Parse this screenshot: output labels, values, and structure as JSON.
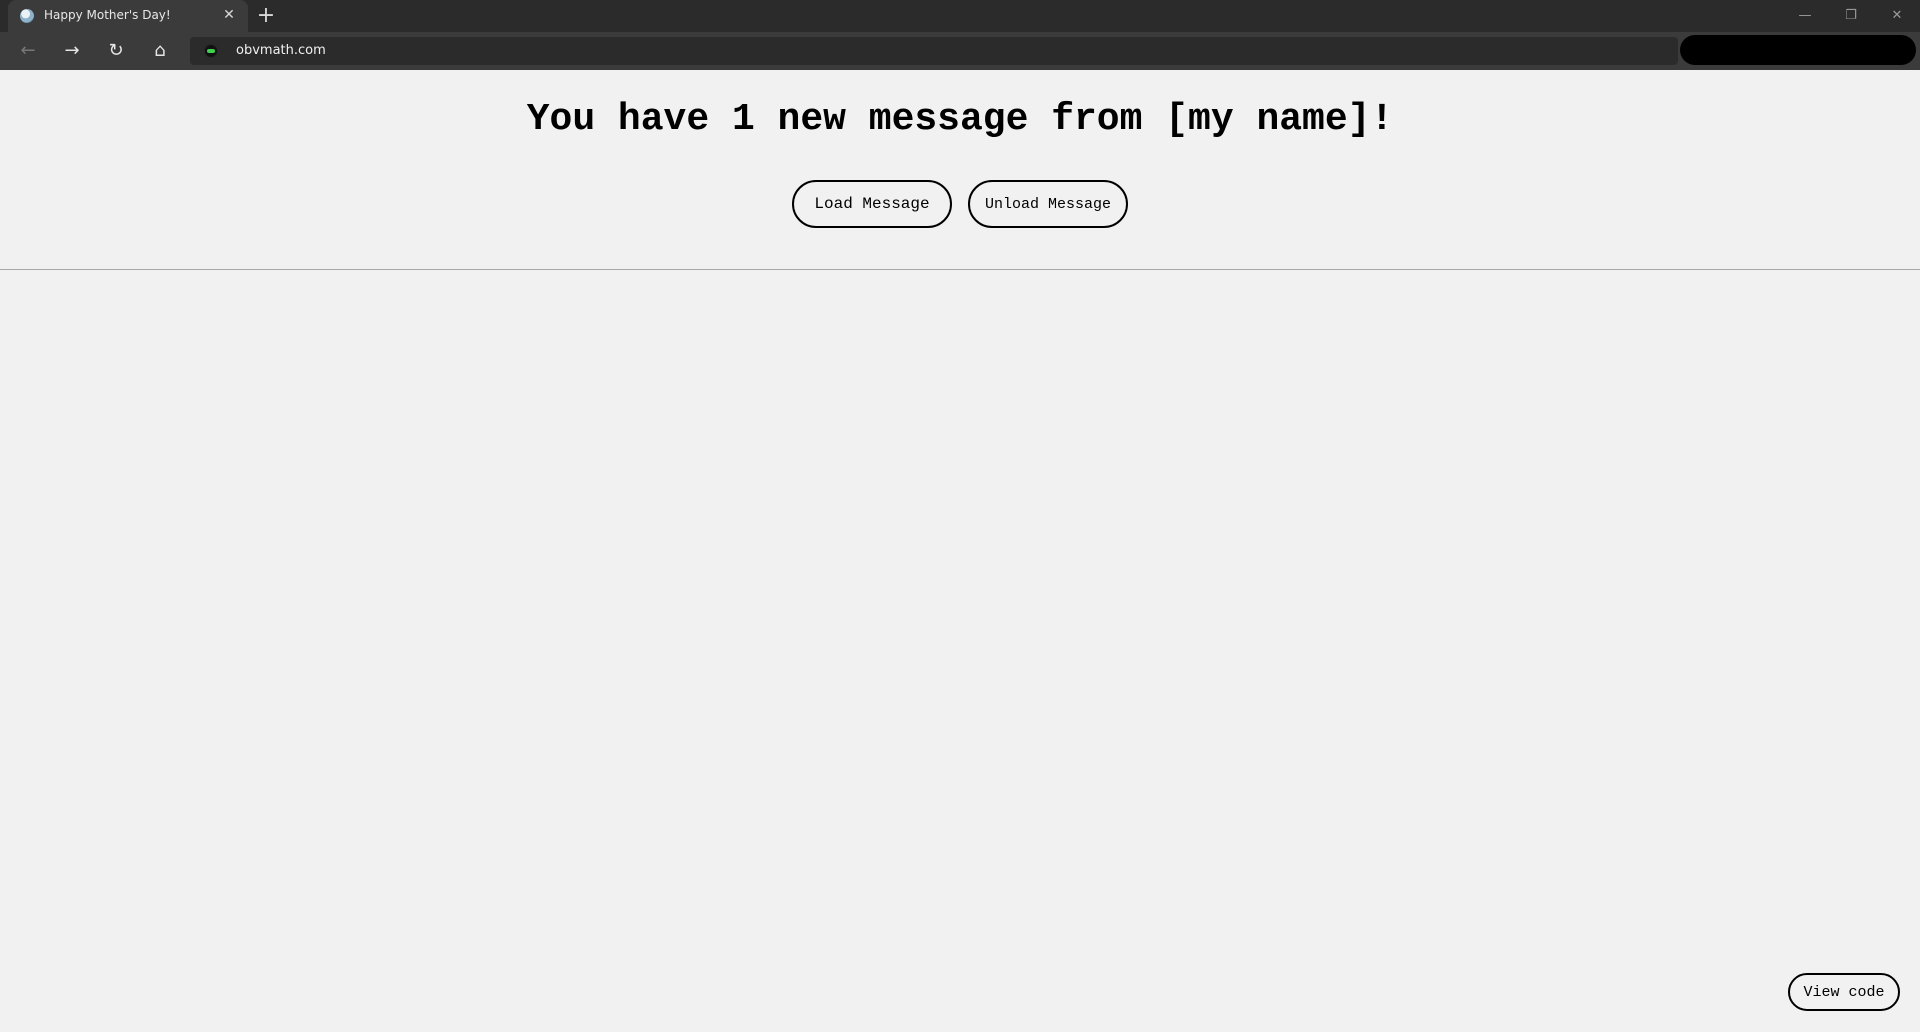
{
  "browser": {
    "tab": {
      "title": "Happy Mother's Day!",
      "close_glyph": "✕",
      "favicon": "globe-favicon"
    },
    "new_tab_glyph": "+",
    "window_controls": {
      "minimize": "—",
      "restore": "❐",
      "close": "✕"
    },
    "nav": {
      "back": "←",
      "forward": "→",
      "reload": "↻",
      "home": "⌂"
    },
    "address": {
      "url": "obvmath.com",
      "site_icon": "site-favicon"
    }
  },
  "page": {
    "headline": "You have 1 new message from [my name]!",
    "buttons": {
      "load": "Load Message",
      "unload": "Unload Message"
    },
    "view_code": "View code"
  },
  "colors": {
    "page_background": "#f1f1f1",
    "chrome_dark": "#2b2b2b",
    "chrome_mid": "#3b3b3b",
    "text": "#000000"
  }
}
